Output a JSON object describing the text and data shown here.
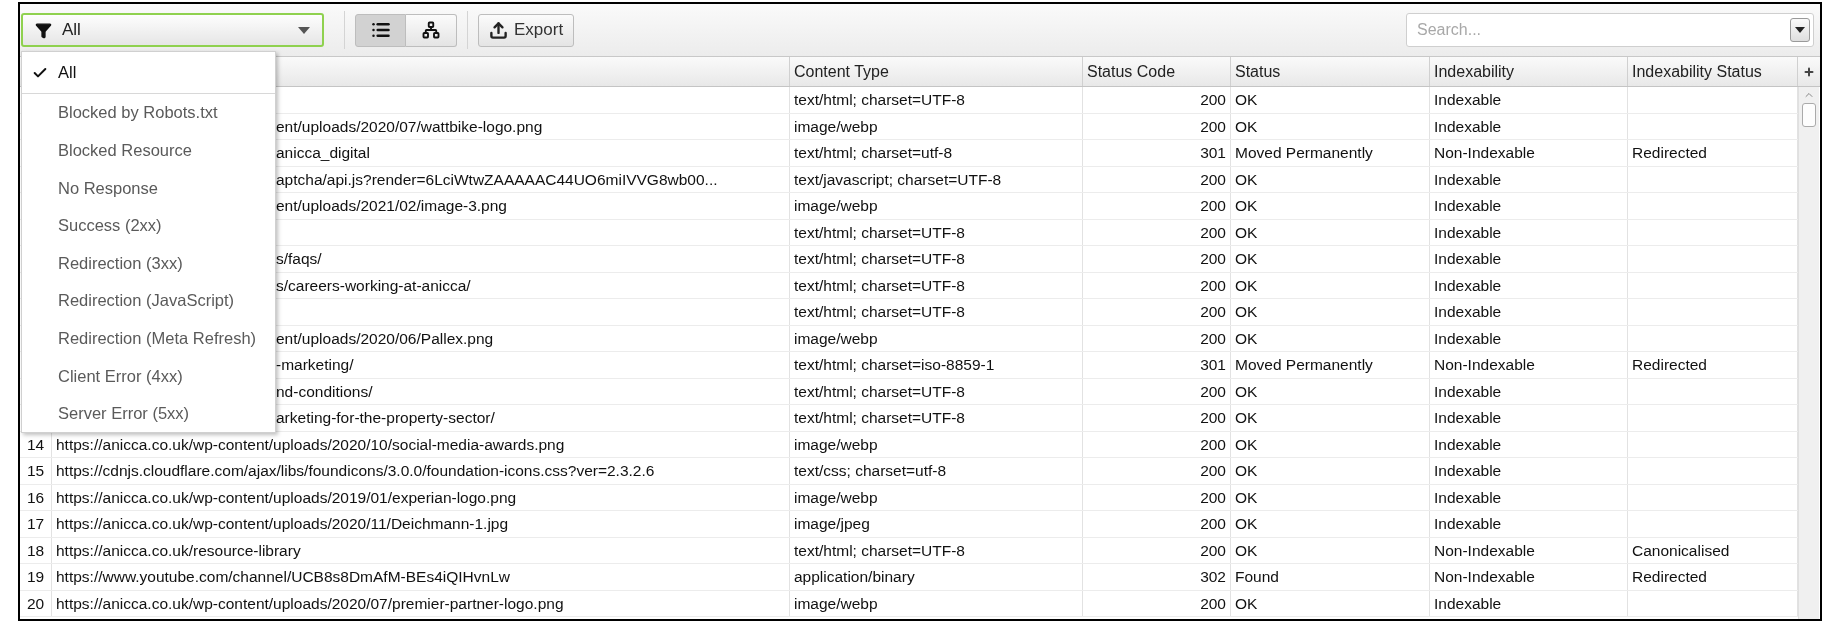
{
  "toolbar": {
    "filter": {
      "value": "All"
    },
    "view_buttons": [
      {
        "kind": "list",
        "selected": true
      },
      {
        "kind": "tree",
        "selected": false
      }
    ],
    "export_button": "Export",
    "search": {
      "placeholder": "Search..."
    }
  },
  "filter_menu": [
    {
      "label": "All",
      "selected": true
    },
    {
      "label": "Blocked by Robots.txt",
      "selected": false
    },
    {
      "label": "Blocked Resource",
      "selected": false
    },
    {
      "label": "No Response",
      "selected": false
    },
    {
      "label": "Success (2xx)",
      "selected": false
    },
    {
      "label": "Redirection (3xx)",
      "selected": false
    },
    {
      "label": "Redirection (JavaScript)",
      "selected": false
    },
    {
      "label": "Redirection (Meta Refresh)",
      "selected": false
    },
    {
      "label": "Client Error (4xx)",
      "selected": false
    },
    {
      "label": "Server Error (5xx)",
      "selected": false
    }
  ],
  "table": {
    "columns": [
      "Content Type",
      "Status Code",
      "Status",
      "Indexability",
      "Indexability Status"
    ],
    "rows": [
      {
        "content_type": "text/html; charset=UTF-8",
        "status_code": "200",
        "status": "OK",
        "indexability": "Indexable"
      },
      {
        "address": "ent/uploads/2020/07/wattbike-logo.png",
        "content_type": "image/webp",
        "status_code": "200",
        "status": "OK",
        "indexability": "Indexable"
      },
      {
        "address": "anicca_digital",
        "content_type": "text/html; charset=utf-8",
        "status_code": "301",
        "status": "Moved Permanently",
        "indexability": "Non-Indexable",
        "indexability_status": "Redirected"
      },
      {
        "address": "aptcha/api.js?render=6LciWtwZAAAAAC44UO6miIVVG8wb00...",
        "content_type": "text/javascript; charset=UTF-8",
        "status_code": "200",
        "status": "OK",
        "indexability": "Indexable"
      },
      {
        "address": "ent/uploads/2021/02/image-3.png",
        "content_type": "image/webp",
        "status_code": "200",
        "status": "OK",
        "indexability": "Indexable"
      },
      {
        "content_type": "text/html; charset=UTF-8",
        "status_code": "200",
        "status": "OK",
        "indexability": "Indexable"
      },
      {
        "address": "s/faqs/",
        "content_type": "text/html; charset=UTF-8",
        "status_code": "200",
        "status": "OK",
        "indexability": "Indexable"
      },
      {
        "address": "s/careers-working-at-anicca/",
        "content_type": "text/html; charset=UTF-8",
        "status_code": "200",
        "status": "OK",
        "indexability": "Indexable"
      },
      {
        "content_type": "text/html; charset=UTF-8",
        "status_code": "200",
        "status": "OK",
        "indexability": "Indexable"
      },
      {
        "address": "ent/uploads/2020/06/Pallex.png",
        "content_type": "image/webp",
        "status_code": "200",
        "status": "OK",
        "indexability": "Indexable"
      },
      {
        "address": "-marketing/",
        "content_type": "text/html; charset=iso-8859-1",
        "status_code": "301",
        "status": "Moved Permanently",
        "indexability": "Non-Indexable",
        "indexability_status": "Redirected"
      },
      {
        "address": "nd-conditions/",
        "content_type": "text/html; charset=UTF-8",
        "status_code": "200",
        "status": "OK",
        "indexability": "Indexable"
      },
      {
        "address": "arketing-for-the-property-sector/",
        "content_type": "text/html; charset=UTF-8",
        "status_code": "200",
        "status": "OK",
        "indexability": "Indexable"
      },
      {
        "number": "14",
        "address": "https://anicca.co.uk/wp-content/uploads/2020/10/social-media-awards.png",
        "content_type": "image/webp",
        "status_code": "200",
        "status": "OK",
        "indexability": "Indexable"
      },
      {
        "number": "15",
        "address": "https://cdnjs.cloudflare.com/ajax/libs/foundicons/3.0.0/foundation-icons.css?ver=2.3.2.6",
        "content_type": "text/css; charset=utf-8",
        "status_code": "200",
        "status": "OK",
        "indexability": "Indexable"
      },
      {
        "number": "16",
        "address": "https://anicca.co.uk/wp-content/uploads/2019/01/experian-logo.png",
        "content_type": "image/webp",
        "status_code": "200",
        "status": "OK",
        "indexability": "Indexable"
      },
      {
        "number": "17",
        "address": "https://anicca.co.uk/wp-content/uploads/2020/11/Deichmann-1.jpg",
        "content_type": "image/jpeg",
        "status_code": "200",
        "status": "OK",
        "indexability": "Indexable"
      },
      {
        "number": "18",
        "address": "https://anicca.co.uk/resource-library",
        "content_type": "text/html; charset=UTF-8",
        "status_code": "200",
        "status": "OK",
        "indexability": "Non-Indexable",
        "indexability_status": "Canonicalised"
      },
      {
        "number": "19",
        "address": "https://www.youtube.com/channel/UCB8s8DmAfM-BEs4iQIHvnLw",
        "content_type": "application/binary",
        "status_code": "302",
        "status": "Found",
        "indexability": "Non-Indexable",
        "indexability_status": "Redirected"
      },
      {
        "number": "20",
        "address": "https://anicca.co.uk/wp-content/uploads/2020/07/premier-partner-logo.png",
        "content_type": "image/webp",
        "status_code": "200",
        "status": "OK",
        "indexability": "Indexable"
      }
    ]
  }
}
